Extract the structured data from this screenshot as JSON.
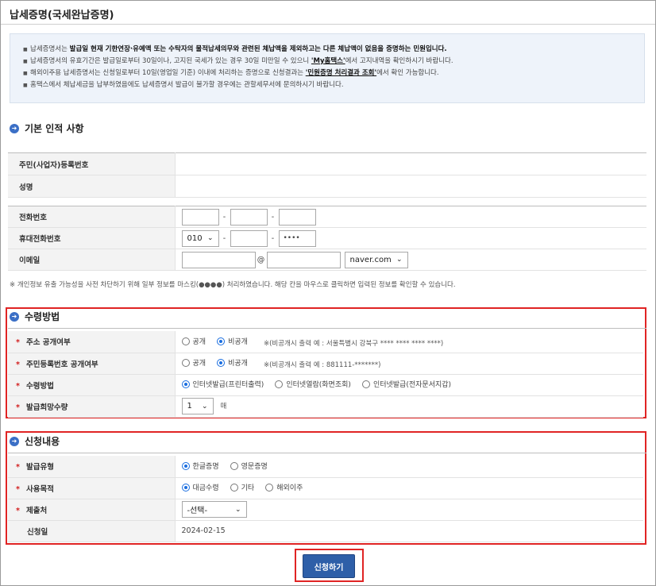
{
  "page": {
    "title": "납세증명(국세완납증명)"
  },
  "notice": [
    {
      "pre": "납세증명서는 ",
      "bold": "발급일 현재 기한연장·유예액 또는 수탁자의 물적납세의무와 관련된 체납액을 제외하고는 다른 체납액이 없음을 증명하는 민원입니다.",
      "link": "",
      "post": ""
    },
    {
      "pre": "납세증명서의 유효기간은 발급일로부터 30일이나, 고지된 국세가 있는 경우 30일 미만일 수 있으니 ",
      "bold": "",
      "link": "'My홈택스'",
      "post": "에서 고지내역을 확인하시기 바랍니다."
    },
    {
      "pre": "해외이주용 납세증명서는 신청일로부터 10일(영업일 기준) 이내에 처리하는 증명으로 신청결과는 ",
      "bold": "",
      "link": "'민원증명 처리결과 조회'",
      "post": "에서 확인 가능합니다."
    },
    {
      "pre": "홈택스에서 체납세금을 납부하였음에도 납세증명서 발급이 불가할 경우에는 관할세무서에 문의하시기 바랍니다.",
      "bold": "",
      "link": "",
      "post": ""
    }
  ],
  "basic": {
    "heading": "기본 인적 사항",
    "id_label": "주민(사업자)등록번호",
    "id_value": "",
    "name_label": "성명",
    "name_value": "",
    "phone_label": "전화번호",
    "phone": [
      "",
      "",
      ""
    ],
    "mobile_label": "휴대전화번호",
    "mobile_prefix": "010",
    "mobile_mid": "",
    "mobile_last": "••••",
    "email_label": "이메일",
    "email_id": "",
    "email_at": "@",
    "email_domain": "",
    "email_select": "naver.com",
    "dash": "-",
    "privacy_note": "※ 개인정보 유출 가능성을 사전 차단하기 위해 일부 정보를 마스킹(●●●●) 처리하였습니다. 해당 칸을 마우스로 클릭하면 입력된 정보를 확인할 수 있습니다."
  },
  "receipt": {
    "heading": "수령방법",
    "address_label": "주소 공개여부",
    "address_opts": [
      "공개",
      "비공개"
    ],
    "address_hint": "※(비공개시 출력 예 : 서울특별시 강북구 **** **** **** ****)",
    "rrn_label": "주민등록번호 공개여부",
    "rrn_opts": [
      "공개",
      "비공개"
    ],
    "rrn_hint": "※(비공개시 출력 예 : 881111-*******)",
    "method_label": "수령방법",
    "method_opts": [
      "인터넷발급(프린터출력)",
      "인터넷열람(화면조회)",
      "인터넷발급(전자문서지갑)"
    ],
    "qty_label": "발급희망수량",
    "qty_value": "1",
    "qty_unit": "매"
  },
  "apply": {
    "heading": "신청내용",
    "type_label": "발급유형",
    "type_opts": [
      "한글증명",
      "영문증명"
    ],
    "purpose_label": "사용목적",
    "purpose_opts": [
      "대금수령",
      "기타",
      "해외이주"
    ],
    "dest_label": "제출처",
    "dest_value": "-선택-",
    "date_label": "신청일",
    "date_value": "2024-02-15"
  },
  "submit_label": "신청하기",
  "required_mark": "*",
  "colors": {
    "accent": "#2e5fa8",
    "highlight": "#e02424",
    "required": "#d21e1e",
    "radio": "#1a6ee0"
  }
}
